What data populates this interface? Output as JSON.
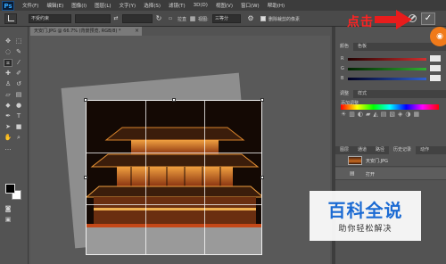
{
  "app": {
    "logo": "Ps"
  },
  "menu": [
    "文件(F)",
    "编辑(E)",
    "图像(I)",
    "图层(L)",
    "文字(Y)",
    "选择(S)",
    "滤镜(T)",
    "3D(D)",
    "视图(V)",
    "窗口(W)",
    "帮助(H)"
  ],
  "options": {
    "ratio_value": "不受约束",
    "field2": "",
    "field3": "",
    "straighten_label": "拉直",
    "view_label": "视图:",
    "view_value": "三等分",
    "delete_pixels_label": "删除裁剪的像素",
    "delete_pixels_checked": true
  },
  "document": {
    "tab_title": "天安门.JPG @ 66.7% (背景预览, RGB/8) *",
    "close_glyph": "×"
  },
  "panels": {
    "color_tabs": [
      "颜色",
      "色板"
    ],
    "color_sliders": [
      {
        "label": "R",
        "color": "#d23030"
      },
      {
        "label": "G",
        "color": "#30b030"
      },
      {
        "label": "B",
        "color": "#3060d0"
      }
    ],
    "adjust_tabs": [
      "调整",
      "样式"
    ],
    "adjust_subtitle": "添加调整",
    "layer_tabs": [
      "图层",
      "通道",
      "路径",
      "历史记录",
      "动作"
    ],
    "layers": [
      {
        "name": "天安门.JPG"
      },
      {
        "name": "打开"
      }
    ]
  },
  "annotation": {
    "text": "点击",
    "color": "#ff2222",
    "arrow_direction": "right"
  },
  "watermark": {
    "title": "百科全说",
    "subtitle": "助你轻松解决"
  }
}
